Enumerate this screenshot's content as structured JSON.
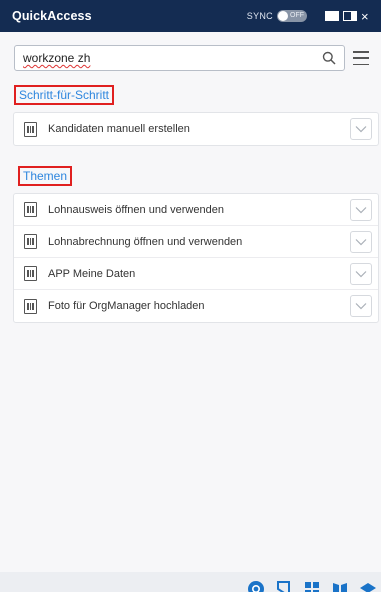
{
  "window": {
    "title": "QuickAccess",
    "sync_label": "SYNC",
    "sync_state": "OFF",
    "controls": [
      "maximize-icon",
      "split-view-icon",
      "close-icon"
    ],
    "close_glyph": "×"
  },
  "search": {
    "value": "workzone zh",
    "icon": "search-icon",
    "menu_icon": "hamburger-menu-icon"
  },
  "sections": [
    {
      "label": "Schritt-für-Schritt",
      "items": [
        {
          "label": "Kandidaten manuell erstellen"
        }
      ]
    },
    {
      "label": "Themen",
      "items": [
        {
          "label": "Lohnausweis öffnen und verwenden"
        },
        {
          "label": "Lohnabrechnung öffnen und verwenden"
        },
        {
          "label": "APP Meine Daten"
        },
        {
          "label": "Foto für OrgManager hochladen"
        }
      ]
    }
  ],
  "bottombar": {
    "icons": [
      "help-icon",
      "bookmark-icon",
      "grid-icon",
      "book-icon",
      "graduation-icon"
    ]
  },
  "colors": {
    "titlebar": "#142c52",
    "section_link": "#2e86de",
    "highlight_border": "#e02020",
    "bottom_icons": "#1a73c8"
  }
}
